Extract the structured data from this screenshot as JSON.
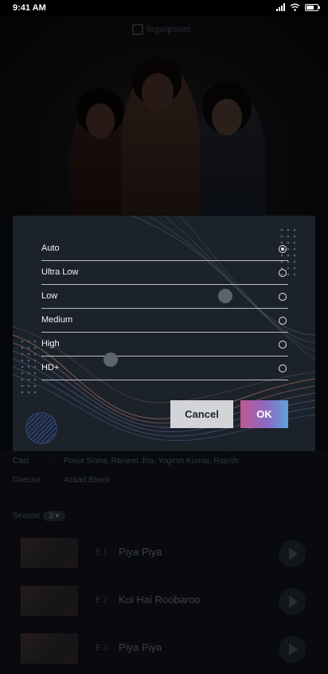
{
  "status_bar": {
    "time": "9:41 AM"
  },
  "hero": {
    "logo_text": "logoipsum"
  },
  "details": {
    "cast_label": "Cast",
    "cast_value": "Pooja Sinha, Ranjeet Jha, Yogesh Kumar, Rajesh",
    "director_label": "Director",
    "director_value": "Azaad Bharti",
    "season_label": "Season",
    "season_value": "2"
  },
  "episodes": [
    {
      "number": "E 1",
      "title": "Piya Piya"
    },
    {
      "number": "E 2",
      "title": "Koi Hai Roobaroo"
    },
    {
      "number": "E 3",
      "title": "Piya Piya"
    }
  ],
  "quality_dialog": {
    "options": [
      {
        "label": "Auto",
        "selected": true
      },
      {
        "label": "Ultra Low",
        "selected": false
      },
      {
        "label": "Low",
        "selected": false
      },
      {
        "label": "Medium",
        "selected": false
      },
      {
        "label": "High",
        "selected": false
      },
      {
        "label": "HD+",
        "selected": false
      }
    ],
    "cancel_label": "Cancel",
    "ok_label": "OK"
  },
  "colors": {
    "dialog_bg": "#1c222a",
    "ok_gradient_start": "#c0588f",
    "ok_gradient_end": "#5fa2d8",
    "cancel_bg": "#d2d4d7"
  }
}
